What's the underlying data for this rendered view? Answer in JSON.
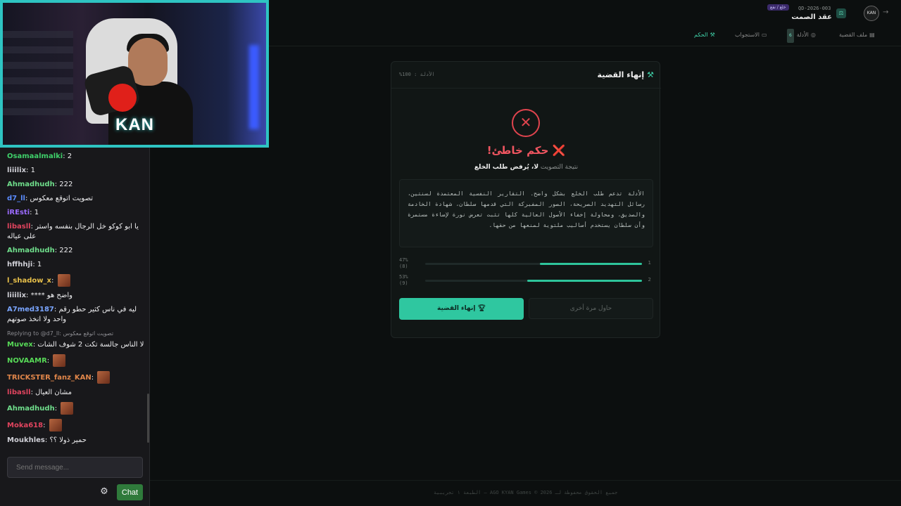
{
  "stream": {
    "webcam_logo": "KAN"
  },
  "chat": {
    "messages": [
      {
        "user": "Osamaalmalki",
        "color": "#3fd06a",
        "text": "2"
      },
      {
        "user": "liiilix",
        "color": "#cfcfd6",
        "text": "1"
      },
      {
        "user": "Ahmadhudh",
        "color": "#6fdd8b",
        "text": "222"
      },
      {
        "user": "d7_ll",
        "color": "#5a8cff",
        "text": "تصويت اتوقع معكوس"
      },
      {
        "user": "iREsti",
        "color": "#9b6bff",
        "text": "1"
      },
      {
        "user": "libasll",
        "color": "#e0445e",
        "text": "يا ابو كوكو خل الرجال بنفسه واستر على عياله"
      },
      {
        "user": "Ahmadhudh",
        "color": "#6fdd8b",
        "text": "222"
      },
      {
        "user": "hffhhji",
        "color": "#cfcfd6",
        "text": "1"
      },
      {
        "user": "l_shadow_x",
        "color": "#e8c04a",
        "text": ""
      },
      {
        "user": "liiilix",
        "color": "#cfcfd6",
        "text": "**** واضح هو"
      },
      {
        "user": "A7med3187",
        "color": "#7aa5ff",
        "text": "ليه في ناس كثير حطو رقم واحد ولا انخذ صوتهم"
      },
      {
        "user": "Muvex",
        "color": "#57d957",
        "text": "لا الناس جالسة تكت 2 شوف الشات",
        "reply": "Replying to @d7_ll: تصويت اتوقع معكوس"
      },
      {
        "user": "NOVAAMR",
        "color": "#57d957",
        "text": ""
      },
      {
        "user": "TRICKSTER_fanz_KAN",
        "color": "#e0864a",
        "text": ""
      },
      {
        "user": "libasll",
        "color": "#e0445e",
        "text": "مشان العيال"
      },
      {
        "user": "Ahmadhudh",
        "color": "#6fdd8b",
        "text": ""
      },
      {
        "user": "Moka618",
        "color": "#e0445e",
        "text": ""
      },
      {
        "user": "Moukhles",
        "color": "#cfcfd6",
        "text": "حمير ذولا ؟؟"
      }
    ],
    "input_placeholder": "Send message...",
    "send_label": "Chat"
  },
  "app": {
    "avatar_text": "KAN",
    "case_id": "QD-2026-003",
    "case_tag": "خلع / نفع",
    "case_title": "عقد الصمت",
    "tabs": [
      {
        "label": "ملف القضية",
        "icon": "file-icon"
      },
      {
        "label": "الأدلة",
        "icon": "fingerprint-icon",
        "count": "6"
      },
      {
        "label": "الاستجواب",
        "icon": "chat-icon"
      },
      {
        "label": "الحكم",
        "icon": "gavel-icon",
        "active": true
      }
    ]
  },
  "verdict": {
    "card_title": "إنهاء القضية",
    "progress_label": "الأدلة : 100%",
    "result_title": "❌ حكم خاطئ!",
    "vote_label": "نتيجة التصويت",
    "vote_value": "لا، يُرفض طلب الخلع",
    "explanation": "الأدلة تدعم طلب الخلع بشكل واضح. التقارير النفسية المعتمدة لسنتين، رسائل التهديد الصريحة، الصور المفبركة التي قدمها سلطان، شهادة الخادمة والصديق، ومحاولة إخفاء الأصول العالية كلها تثبت تعرض نورة لإساءة مستمرة وأن سلطان يستخدم أساليب ملتوية لمنعها من حقها.",
    "votes": [
      {
        "option": "1",
        "percent": 47,
        "percent_label": "47%",
        "count_label": "(8)"
      },
      {
        "option": "2",
        "percent": 53,
        "percent_label": "53%",
        "count_label": "(9)"
      }
    ],
    "retry_label": "حاول مرة أخرى",
    "end_label": "إنهاء القضية"
  },
  "footer": {
    "text": "جميع الحقوق محفوظة لـ AGO KYAN Games © 2026 — الطبعة ١ تجريبية"
  }
}
